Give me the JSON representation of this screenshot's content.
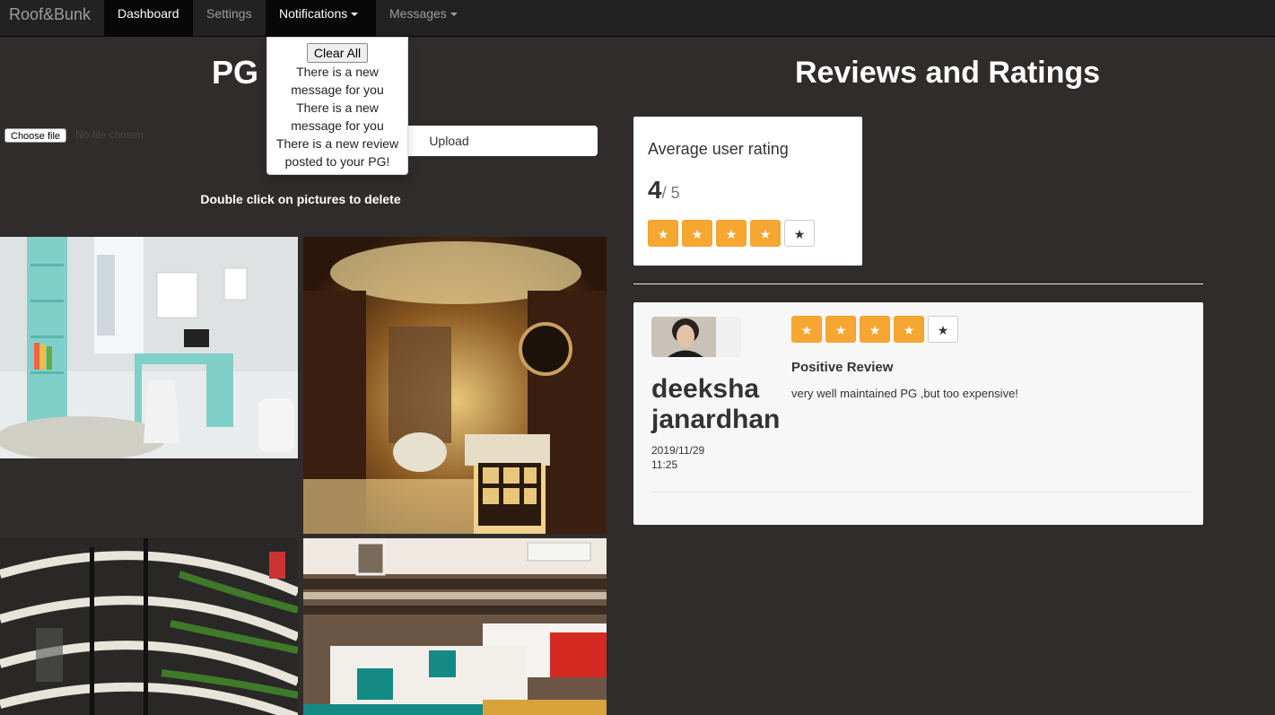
{
  "navbar": {
    "brand": "Roof&Bunk",
    "items": [
      {
        "label": "Dashboard"
      },
      {
        "label": "Settings"
      },
      {
        "label": "Notifications"
      },
      {
        "label": "Messages"
      }
    ]
  },
  "notifications": {
    "clear_label": "Clear All",
    "items": [
      {
        "text": "There is a new message for you"
      },
      {
        "text": "There is a new message for you"
      },
      {
        "text": "There is a new review posted to your PG!"
      }
    ]
  },
  "gallery": {
    "title": "PG",
    "choose_file_label": "Choose file",
    "no_file_text": "No file chosen",
    "upload_label": "Upload",
    "hint": "Double click on pictures to delete"
  },
  "reviews": {
    "title": "Reviews and Ratings",
    "average_label": "Average user rating",
    "average_value": "4",
    "average_max": "/ 5",
    "average_stars": 4,
    "items": [
      {
        "name": "deeksha janardhan",
        "date": "2019/11/29",
        "time": "11:25",
        "stars": 4,
        "title": "Positive Review",
        "text": "very well maintained PG ,but too expensive!"
      }
    ]
  },
  "colors": {
    "background": "#302c2b",
    "navbar": "#222222",
    "star_active": "#f5a732"
  },
  "icons": {
    "star": "★",
    "caret": "caret-down-icon"
  }
}
